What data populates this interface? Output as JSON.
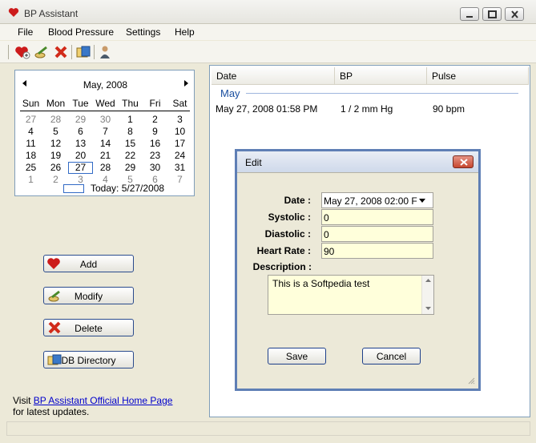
{
  "window": {
    "title": "BP Assistant"
  },
  "menu": [
    "File",
    "Blood Pressure",
    "Settings",
    "Help"
  ],
  "toolbar": {
    "icons": [
      "add-heart-icon",
      "modify-icon",
      "delete-icon",
      "db-directory-icon",
      "user-icon"
    ]
  },
  "calendar": {
    "month_label": "May, 2008",
    "weekdays": [
      "Sun",
      "Mon",
      "Tue",
      "Wed",
      "Thu",
      "Fri",
      "Sat"
    ],
    "weeks": [
      [
        "27",
        "28",
        "29",
        "30",
        "1",
        "2",
        "3"
      ],
      [
        "4",
        "5",
        "6",
        "7",
        "8",
        "9",
        "10"
      ],
      [
        "11",
        "12",
        "13",
        "14",
        "15",
        "16",
        "17"
      ],
      [
        "18",
        "19",
        "20",
        "21",
        "22",
        "23",
        "24"
      ],
      [
        "25",
        "26",
        "27",
        "28",
        "29",
        "30",
        "31"
      ],
      [
        "1",
        "2",
        "3",
        "4",
        "5",
        "6",
        "7"
      ]
    ],
    "selected_day": "27",
    "today_label": "Today: 5/27/2008"
  },
  "actions": {
    "add": "Add",
    "modify": "Modify",
    "delete": "Delete",
    "db_directory": "DB Directory"
  },
  "footer": {
    "visit": "Visit ",
    "link": "BP Assistant Official Home Page",
    "updates": "for latest updates."
  },
  "list": {
    "columns": [
      "Date",
      "BP",
      "Pulse"
    ],
    "group": "May",
    "rows": [
      {
        "date": "May 27, 2008 01:58 PM",
        "bp": "1 / 2 mm Hg",
        "pulse": "90 bpm"
      }
    ]
  },
  "dialog": {
    "title": "Edit",
    "labels": {
      "date": "Date :",
      "systolic": "Systolic :",
      "diastolic": "Diastolic :",
      "heart_rate": "Heart Rate :",
      "description": "Description :"
    },
    "values": {
      "date": "May 27, 2008 02:00 F",
      "systolic": "0",
      "diastolic": "0",
      "heart_rate": "90",
      "description": "This is a Softpedia test"
    },
    "save": "Save",
    "cancel": "Cancel"
  },
  "colors": {
    "accent": "#316ac5",
    "field_bg": "#ffffdb",
    "heart": "#cc1b1b",
    "group_text": "#1a4fa0"
  }
}
